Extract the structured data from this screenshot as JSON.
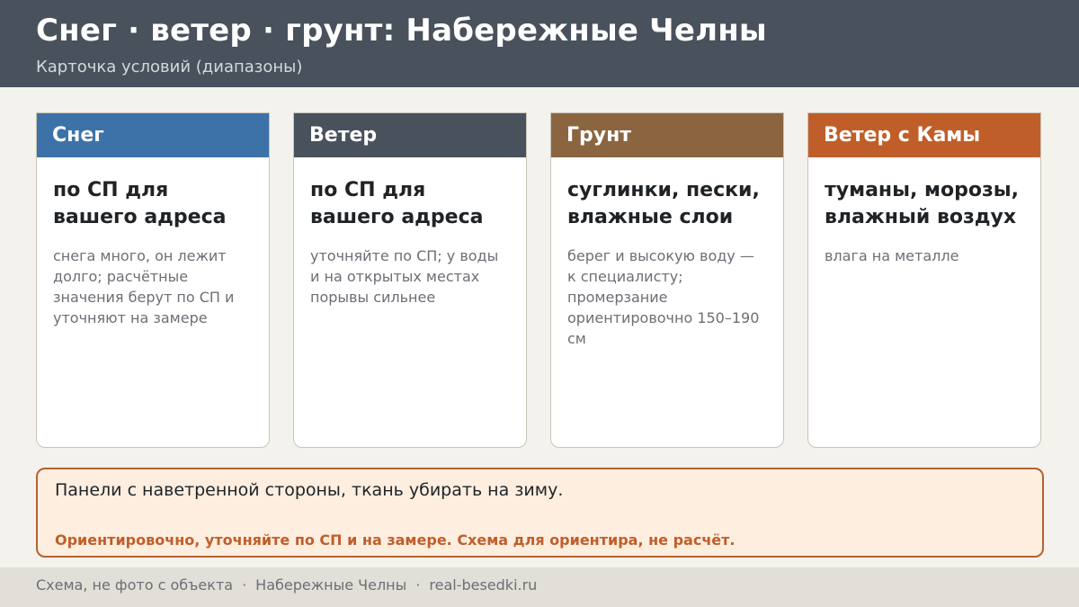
{
  "header": {
    "title": "Снег · ветер · грунт: Набережные Челны",
    "subtitle": "Карточка условий (диапазоны)"
  },
  "cards": [
    {
      "title": "Снег",
      "color": "#3d72a8",
      "main": "по СП для вашего адреса",
      "note": "снега много, он лежит долго; расчётные значения берут по СП и уточняют на замере"
    },
    {
      "title": "Ветер",
      "color": "#48515c",
      "main": "по СП для вашего адреса",
      "note": "уточняйте по СП; у воды и на открытых местах порывы сильнее"
    },
    {
      "title": "Грунт",
      "color": "#8b6540",
      "main": "суглинки, пески, влажные слои",
      "note": "берег и высокую воду — к специалисту; промерзание ориентировочно 150–190 см"
    },
    {
      "title": "Ветер с Камы",
      "color": "#c05e2a",
      "main": "туманы, морозы, влажный воздух",
      "note": "влага на металле"
    }
  ],
  "notice": {
    "text": "Панели с наветренной стороны, ткань убирать на зиму.",
    "warning": "Ориентировочно, уточняйте по СП и на замере. Схема для ориентира, не расчёт."
  },
  "footer": {
    "disclaimer": "Схема, не фото с объекта",
    "city": "Набережные Челны",
    "site": "real-besedki.ru",
    "separator": "·"
  },
  "colors": {
    "header_bg": "#48515c",
    "page_bg": "#f4f2ed",
    "notice_bg": "#fdeee0",
    "notice_border": "#b4622e",
    "accent": "#c05e2a"
  }
}
